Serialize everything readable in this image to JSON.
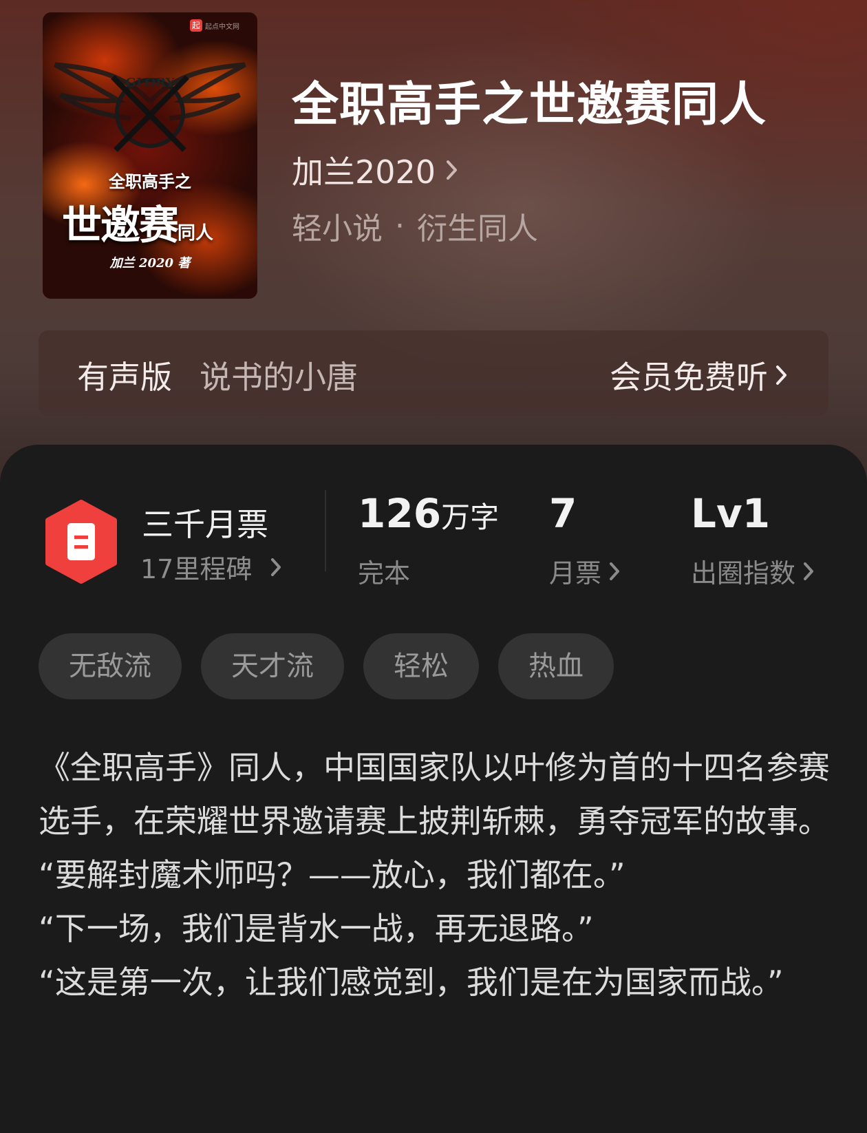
{
  "book": {
    "title": "全职高手之世邀赛同人",
    "author": "加兰2020",
    "category": "轻小说",
    "separator": "·",
    "subcategory": "衍生同人"
  },
  "cover": {
    "logo_text": "起点中文网",
    "emblem_text": "GLORY",
    "subtitle": "全职高手之",
    "main_title": "世邀赛",
    "main_suffix": "同人",
    "author_line": "加兰 2020  著"
  },
  "audio": {
    "label": "有声版",
    "narrator": "说书的小唐",
    "action": "会员免费听"
  },
  "stats": {
    "ticket": {
      "title": "三千月票",
      "subtitle": "17里程碑"
    },
    "word_count": {
      "value": "126",
      "unit": "万字",
      "label": "完本"
    },
    "monthly_votes": {
      "value": "7",
      "label": "月票"
    },
    "influence": {
      "value": "Lv1",
      "label": "出圈指数"
    }
  },
  "tags": [
    "无敌流",
    "天才流",
    "轻松",
    "热血"
  ],
  "description": "《全职高手》同人，中国国家队以叶修为首的十四名参赛选手，在荣耀世界邀请赛上披荆斩棘，勇夺冠军的故事。\n“要解封魔术师吗？——放心，我们都在。”\n“下一场，我们是背水一战，再无退路。”\n“这是第一次，让我们感觉到，我们是在为国家而战。”",
  "colors": {
    "badge": "#f0403e",
    "panel": "#1b1b1b",
    "hero": "#553b36"
  }
}
